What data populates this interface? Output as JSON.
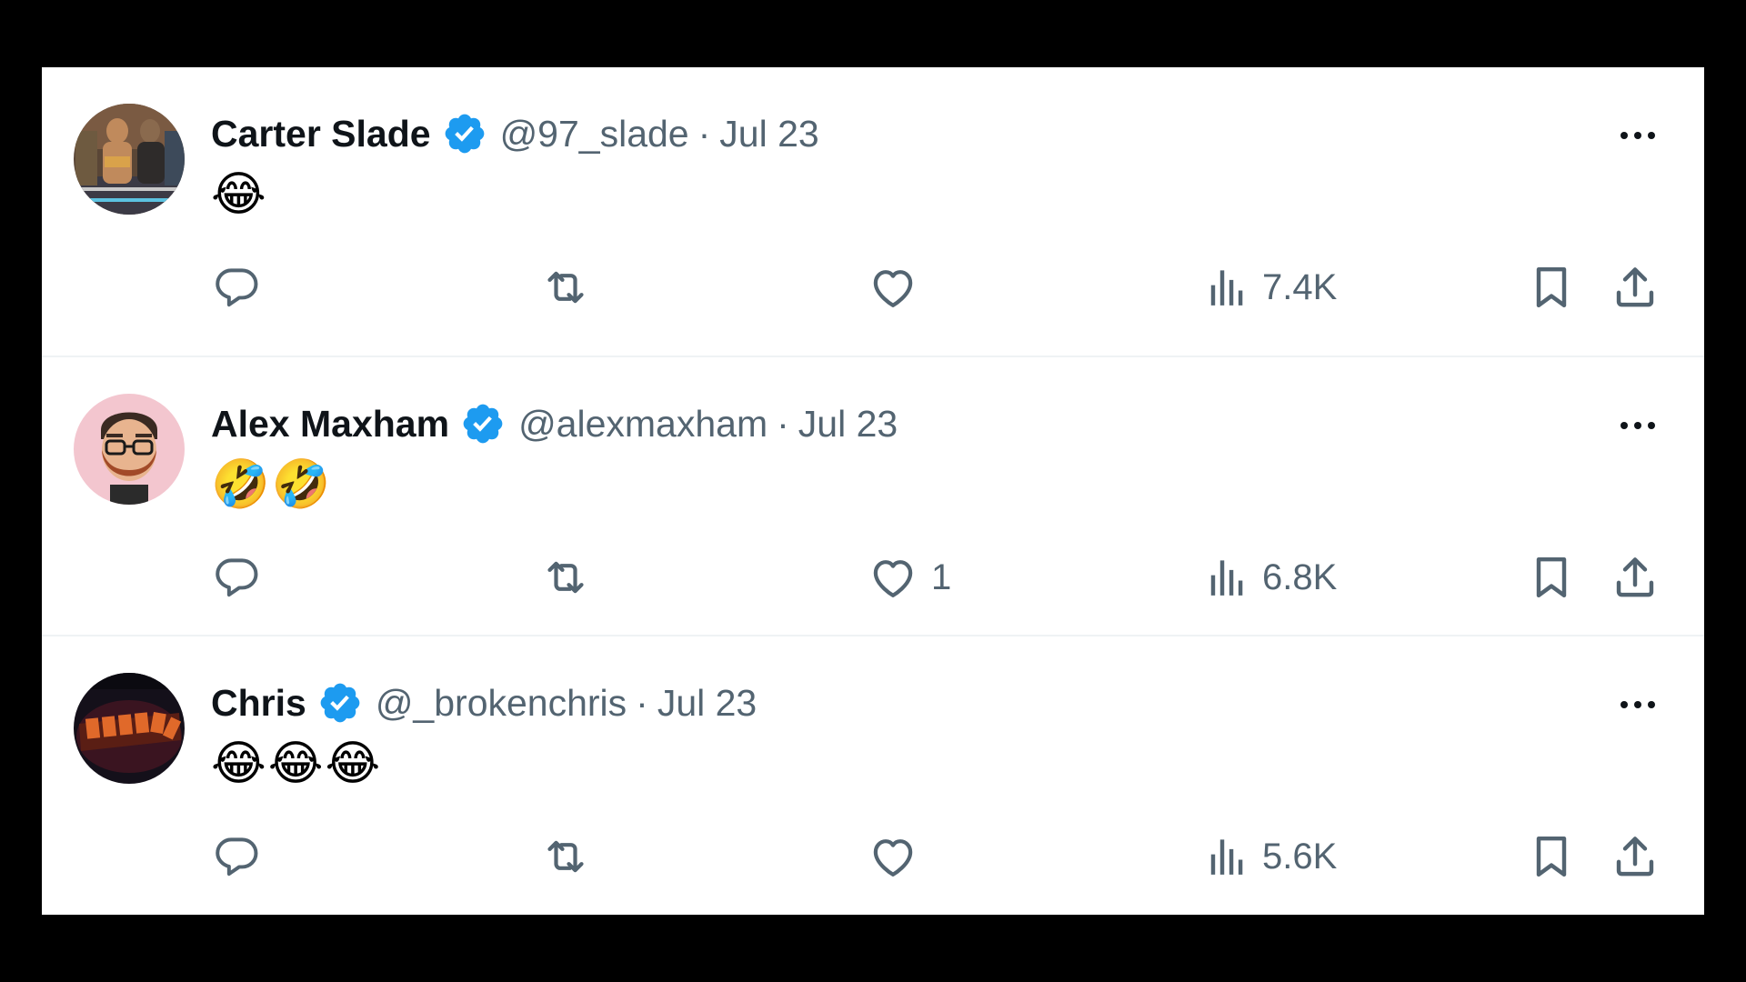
{
  "colors": {
    "text": "#0f1419",
    "muted": "#536471",
    "verified": "#1d9bf0",
    "divider": "#eff3f4"
  },
  "tweets": [
    {
      "name": "Carter Slade",
      "handle": "@97_slade",
      "separator": "·",
      "date": "Jul 23",
      "text": "😂",
      "replies": "",
      "retweets": "",
      "likes": "",
      "views": "7.4K",
      "avatar_icon": "wrestlers-photo-avatar"
    },
    {
      "name": "Alex Maxham",
      "handle": "@alexmaxham",
      "separator": "·",
      "date": "Jul 23",
      "text": "🤣🤣",
      "replies": "",
      "retweets": "",
      "likes": "1",
      "views": "6.8K",
      "avatar_icon": "bearded-man-illustration-avatar"
    },
    {
      "name": "Chris",
      "handle": "@_brokenchris",
      "separator": "·",
      "date": "Jul 23",
      "text": "😂😂😂",
      "replies": "",
      "retweets": "",
      "likes": "",
      "views": "5.6K",
      "avatar_icon": "broken-logo-avatar"
    }
  ]
}
